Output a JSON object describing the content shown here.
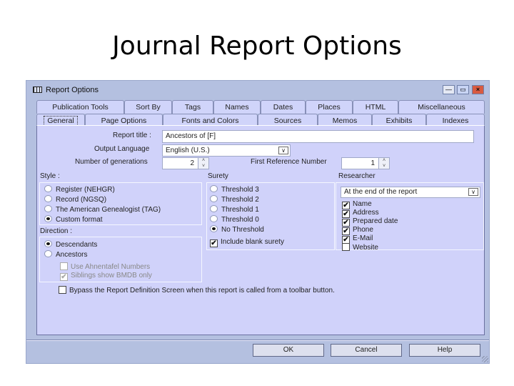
{
  "slide": {
    "title": "Journal Report Options"
  },
  "window": {
    "title": "Report Options",
    "controls": {
      "minimize": "—",
      "maximize": "▭",
      "close": "×"
    }
  },
  "tabs_row1": [
    "Publication Tools",
    "Sort By",
    "Tags",
    "Names",
    "Dates",
    "Places",
    "HTML",
    "Miscellaneous"
  ],
  "tabs_row2": [
    "General",
    "Page Options",
    "Fonts and Colors",
    "Sources",
    "Memos",
    "Exhibits",
    "Indexes"
  ],
  "active_tab": "General",
  "general": {
    "report_title_label": "Report title :",
    "report_title_value": "Ancestors of [F]",
    "output_language_label": "Output Language",
    "output_language_value": "English (U.S.)",
    "generations_label": "Number of generations",
    "generations_value": "2",
    "first_ref_label": "First Reference Number",
    "first_ref_value": "1",
    "style_label": "Style :",
    "style_options": [
      {
        "label": "Register (NEHGR)",
        "selected": false
      },
      {
        "label": "Record (NGSQ)",
        "selected": false
      },
      {
        "label": "The American Genealogist (TAG)",
        "selected": false
      },
      {
        "label": "Custom format",
        "selected": true
      }
    ],
    "direction_label": "Direction :",
    "direction_options": [
      {
        "label": "Descendants",
        "selected": true
      },
      {
        "label": "Ancestors",
        "selected": false
      }
    ],
    "direction_checks": [
      {
        "label": "Use Ahnentafel Numbers",
        "checked": false,
        "disabled": true
      },
      {
        "label": "Siblings show BMDB only",
        "checked": true,
        "disabled": true
      }
    ],
    "surety_label": "Surety",
    "surety_options": [
      {
        "label": "Threshold 3",
        "selected": false
      },
      {
        "label": "Threshold 2",
        "selected": false
      },
      {
        "label": "Threshold 1",
        "selected": false
      },
      {
        "label": "Threshold 0",
        "selected": false
      },
      {
        "label": "No Threshold",
        "selected": true
      }
    ],
    "include_blank_surety": {
      "label": "Include blank surety",
      "checked": true
    },
    "researcher_label": "Researcher",
    "researcher_position": "At the end of the report",
    "researcher_fields": [
      {
        "label": "Name",
        "checked": true
      },
      {
        "label": "Address",
        "checked": true
      },
      {
        "label": "Prepared date",
        "checked": true
      },
      {
        "label": "Phone",
        "checked": true
      },
      {
        "label": "E-Mail",
        "checked": true
      },
      {
        "label": "Website",
        "checked": false
      }
    ],
    "bypass": {
      "label": "Bypass the Report Definition Screen when this report is called from a toolbar button.",
      "checked": false
    }
  },
  "buttons": {
    "ok": "OK",
    "cancel": "Cancel",
    "help": "Help"
  },
  "glyphs": {
    "check": "✔",
    "dropdown": "∨",
    "spin_up": "˄",
    "spin_down": "˅"
  }
}
